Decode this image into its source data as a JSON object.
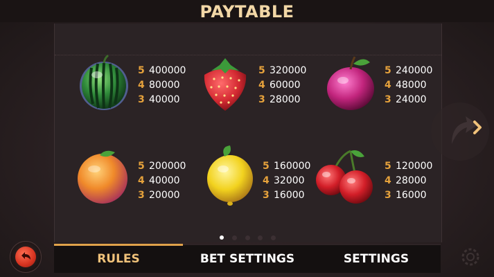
{
  "title": "PAYTABLE",
  "paytable": [
    {
      "symbol": "watermelon",
      "pays": [
        {
          "count": "5",
          "value": "400000"
        },
        {
          "count": "4",
          "value": "80000"
        },
        {
          "count": "3",
          "value": "40000"
        }
      ]
    },
    {
      "symbol": "strawberry",
      "pays": [
        {
          "count": "5",
          "value": "320000"
        },
        {
          "count": "4",
          "value": "60000"
        },
        {
          "count": "3",
          "value": "28000"
        }
      ]
    },
    {
      "symbol": "plum",
      "pays": [
        {
          "count": "5",
          "value": "240000"
        },
        {
          "count": "4",
          "value": "48000"
        },
        {
          "count": "3",
          "value": "24000"
        }
      ]
    },
    {
      "symbol": "orange",
      "pays": [
        {
          "count": "5",
          "value": "200000"
        },
        {
          "count": "4",
          "value": "40000"
        },
        {
          "count": "3",
          "value": "20000"
        }
      ]
    },
    {
      "symbol": "lemon",
      "pays": [
        {
          "count": "5",
          "value": "160000"
        },
        {
          "count": "4",
          "value": "32000"
        },
        {
          "count": "3",
          "value": "16000"
        }
      ]
    },
    {
      "symbol": "cherry",
      "pays": [
        {
          "count": "5",
          "value": "120000"
        },
        {
          "count": "4",
          "value": "28000"
        },
        {
          "count": "3",
          "value": "16000"
        }
      ]
    }
  ],
  "pager": {
    "pages": 5,
    "current": 1
  },
  "tabs": [
    {
      "label": "RULES",
      "active": true
    },
    {
      "label": "BET SETTINGS",
      "active": false
    },
    {
      "label": "SETTINGS",
      "active": false
    }
  ],
  "icons": {
    "back": "back-arrow-icon",
    "next": "chevron-right-icon",
    "settings": "gear-icon"
  },
  "colors": {
    "title": "#f2d7a6",
    "count": "#e6a23c",
    "value": "#ffffff",
    "active_tab": "#f0c27a",
    "tab_underline": "#e0a24a",
    "back_button": "#d5321f"
  }
}
